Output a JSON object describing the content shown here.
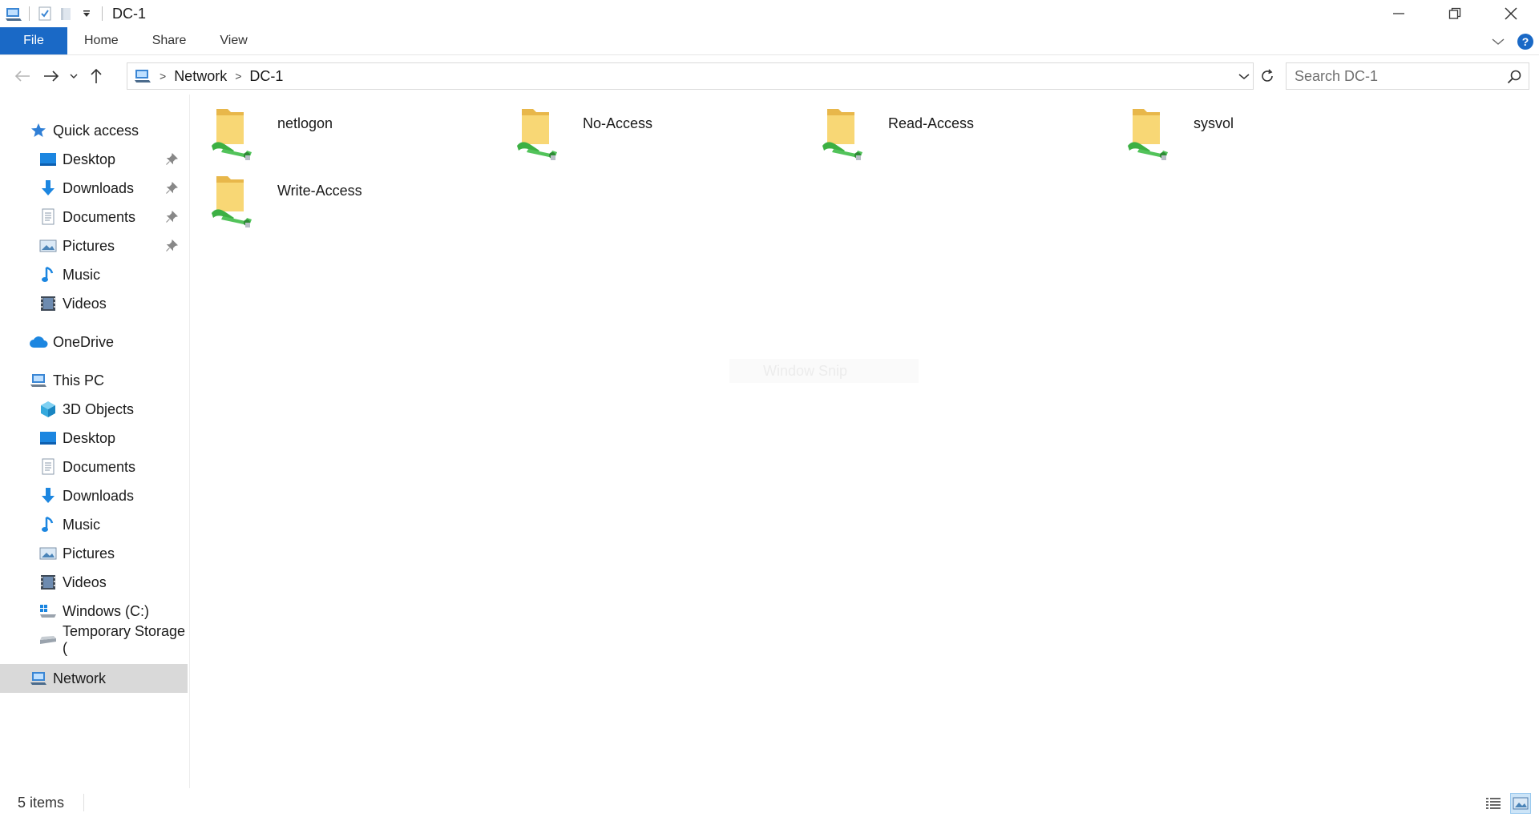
{
  "window": {
    "title": "DC-1",
    "minimize_icon": "minimize-icon",
    "restore_icon": "restore-icon",
    "close_icon": "close-icon"
  },
  "ribbon": {
    "tabs": [
      {
        "label": "File"
      },
      {
        "label": "Home"
      },
      {
        "label": "Share"
      },
      {
        "label": "View"
      }
    ]
  },
  "address": {
    "crumbs": [
      "Network",
      "DC-1"
    ],
    "search_placeholder": "Search DC-1"
  },
  "sidebar": {
    "quick_access": "Quick access",
    "quick_items": [
      {
        "label": "Desktop",
        "pinned": true
      },
      {
        "label": "Downloads",
        "pinned": true
      },
      {
        "label": "Documents",
        "pinned": true
      },
      {
        "label": "Pictures",
        "pinned": true
      },
      {
        "label": "Music"
      },
      {
        "label": "Videos"
      }
    ],
    "onedrive": "OneDrive",
    "this_pc": "This PC",
    "pc_items": [
      {
        "label": "3D Objects"
      },
      {
        "label": "Desktop"
      },
      {
        "label": "Documents"
      },
      {
        "label": "Downloads"
      },
      {
        "label": "Music"
      },
      {
        "label": "Pictures"
      },
      {
        "label": "Videos"
      },
      {
        "label": "Windows (C:)"
      },
      {
        "label": "Temporary Storage ("
      }
    ],
    "network": "Network"
  },
  "content": {
    "folders": [
      {
        "name": "netlogon"
      },
      {
        "name": "No-Access"
      },
      {
        "name": "Read-Access"
      },
      {
        "name": "sysvol"
      },
      {
        "name": "Write-Access"
      }
    ],
    "overlay_text": "Window Snip"
  },
  "status": {
    "item_count": "5 items"
  },
  "colors": {
    "file_tab": "#1a69c6",
    "folder_yellow": "#f8d775",
    "share_green": "#3cb043",
    "selected_nav": "#d9d9d9",
    "accent_blue": "#1a69c6"
  }
}
